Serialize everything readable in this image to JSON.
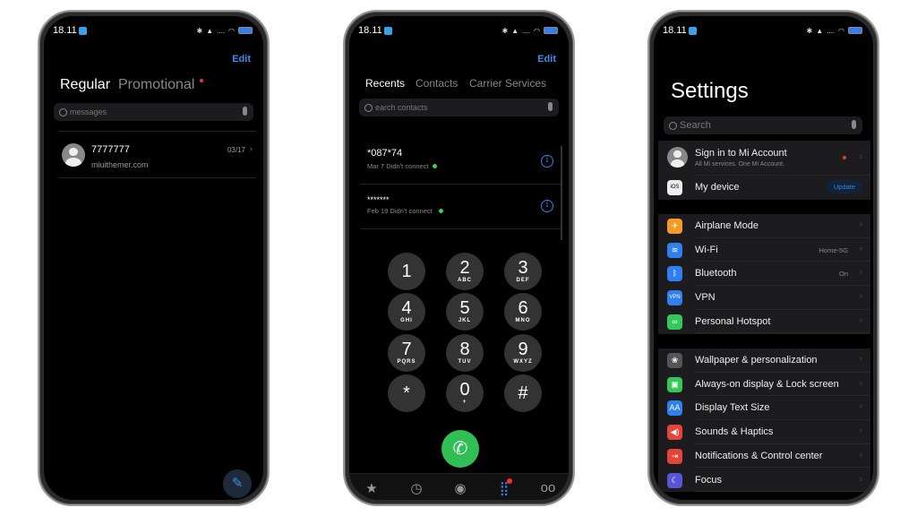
{
  "status": {
    "time": "18.11"
  },
  "messages": {
    "edit": "Edit",
    "tabs": [
      "Regular",
      "Promotional"
    ],
    "search_placeholder": "messages",
    "thread": {
      "name": "7777777",
      "preview": "miuithemer.com",
      "date": "03/17"
    },
    "compose_icon": "compose-icon"
  },
  "phone": {
    "edit": "Edit",
    "tabs": [
      "Recents",
      "Contacts",
      "Carrier Services"
    ],
    "search_placeholder": "earch contacts",
    "recents": [
      {
        "number": "*087*74",
        "detail": "Mar 7 Didn't connect"
      },
      {
        "number": "*******",
        "detail": "Feb 19 Didn't connect"
      }
    ],
    "keys": [
      {
        "d": "1",
        "s": ""
      },
      {
        "d": "2",
        "s": "ABC"
      },
      {
        "d": "3",
        "s": "DEF"
      },
      {
        "d": "4",
        "s": "GHI"
      },
      {
        "d": "5",
        "s": "JKL"
      },
      {
        "d": "6",
        "s": "MNO"
      },
      {
        "d": "7",
        "s": "PQRS"
      },
      {
        "d": "8",
        "s": "TUV"
      },
      {
        "d": "9",
        "s": "WXYZ"
      },
      {
        "d": "*",
        "s": ""
      },
      {
        "d": "0",
        "s": "+"
      },
      {
        "d": "#",
        "s": ""
      }
    ],
    "call_color": "#2fbf55",
    "bottom_tabs": [
      "favorites-star-icon",
      "recents-clock-icon",
      "contacts-person-icon",
      "keypad-grid-icon",
      "voicemail-icon"
    ]
  },
  "settings": {
    "title": "Settings",
    "search_placeholder": "Search",
    "account": {
      "title": "Sign in to Mi Account",
      "subtitle": "All Mi services. One Mi Account."
    },
    "device": {
      "label": "My device",
      "button": "Update",
      "logo": "iOS"
    },
    "group2": [
      {
        "label": "Airplane Mode",
        "value": "",
        "color": "#f59a23",
        "glyph": "✈",
        "icon": "airplane-icon"
      },
      {
        "label": "Wi-Fi",
        "value": "Home-5G",
        "color": "#2f7ff0",
        "glyph": "≋",
        "icon": "wifi-icon"
      },
      {
        "label": "Bluetooth",
        "value": "On",
        "color": "#2f7ff0",
        "glyph": "ᛒ",
        "icon": "bluetooth-icon"
      },
      {
        "label": "VPN",
        "value": "",
        "color": "#2f7ff0",
        "glyph": "VPN",
        "icon": "vpn-icon"
      },
      {
        "label": "Personal Hotspot",
        "value": "",
        "color": "#34c759",
        "glyph": "∞",
        "icon": "hotspot-icon"
      }
    ],
    "group3": [
      {
        "label": "Wallpaper & personalization",
        "value": "",
        "color": "#555",
        "glyph": "❀",
        "icon": "wallpaper-icon"
      },
      {
        "label": "Always-on display & Lock screen",
        "value": "",
        "color": "#34c759",
        "glyph": "▣",
        "icon": "lock-screen-icon"
      },
      {
        "label": "Display Text Size",
        "value": "",
        "color": "#2f7ff0",
        "glyph": "AA",
        "icon": "text-size-icon"
      },
      {
        "label": "Sounds & Haptics",
        "value": "",
        "color": "#e5443a",
        "glyph": "◀)",
        "icon": "sound-icon"
      },
      {
        "label": "Notifications & Control center",
        "value": "",
        "color": "#e5443a",
        "glyph": "⇥",
        "icon": "notifications-icon"
      },
      {
        "label": "Focus",
        "value": "",
        "color": "#5856d6",
        "glyph": "☾",
        "icon": "focus-moon-icon"
      }
    ]
  }
}
